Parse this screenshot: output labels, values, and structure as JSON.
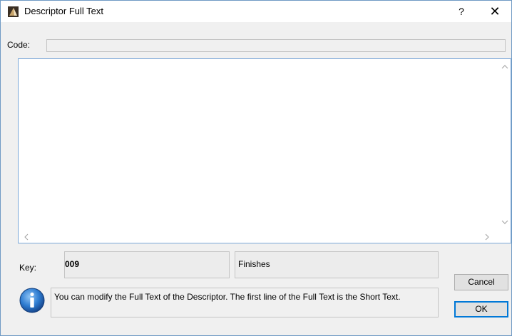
{
  "window": {
    "title": "Descriptor Full Text",
    "help_label": "?",
    "close_label": "✕"
  },
  "code": {
    "label": "Code:",
    "value": ""
  },
  "full_text": {
    "value": ""
  },
  "key": {
    "label": "Key:",
    "value": "009",
    "name": "Finishes"
  },
  "message": {
    "text": "You can modify the Full Text of the Descriptor. The first line of the Full Text is the Short Text."
  },
  "buttons": {
    "cancel_label": "Cancel",
    "ok_label": "OK"
  },
  "colors": {
    "accent": "#0078d7",
    "info_icon": "#1a5fb4"
  }
}
